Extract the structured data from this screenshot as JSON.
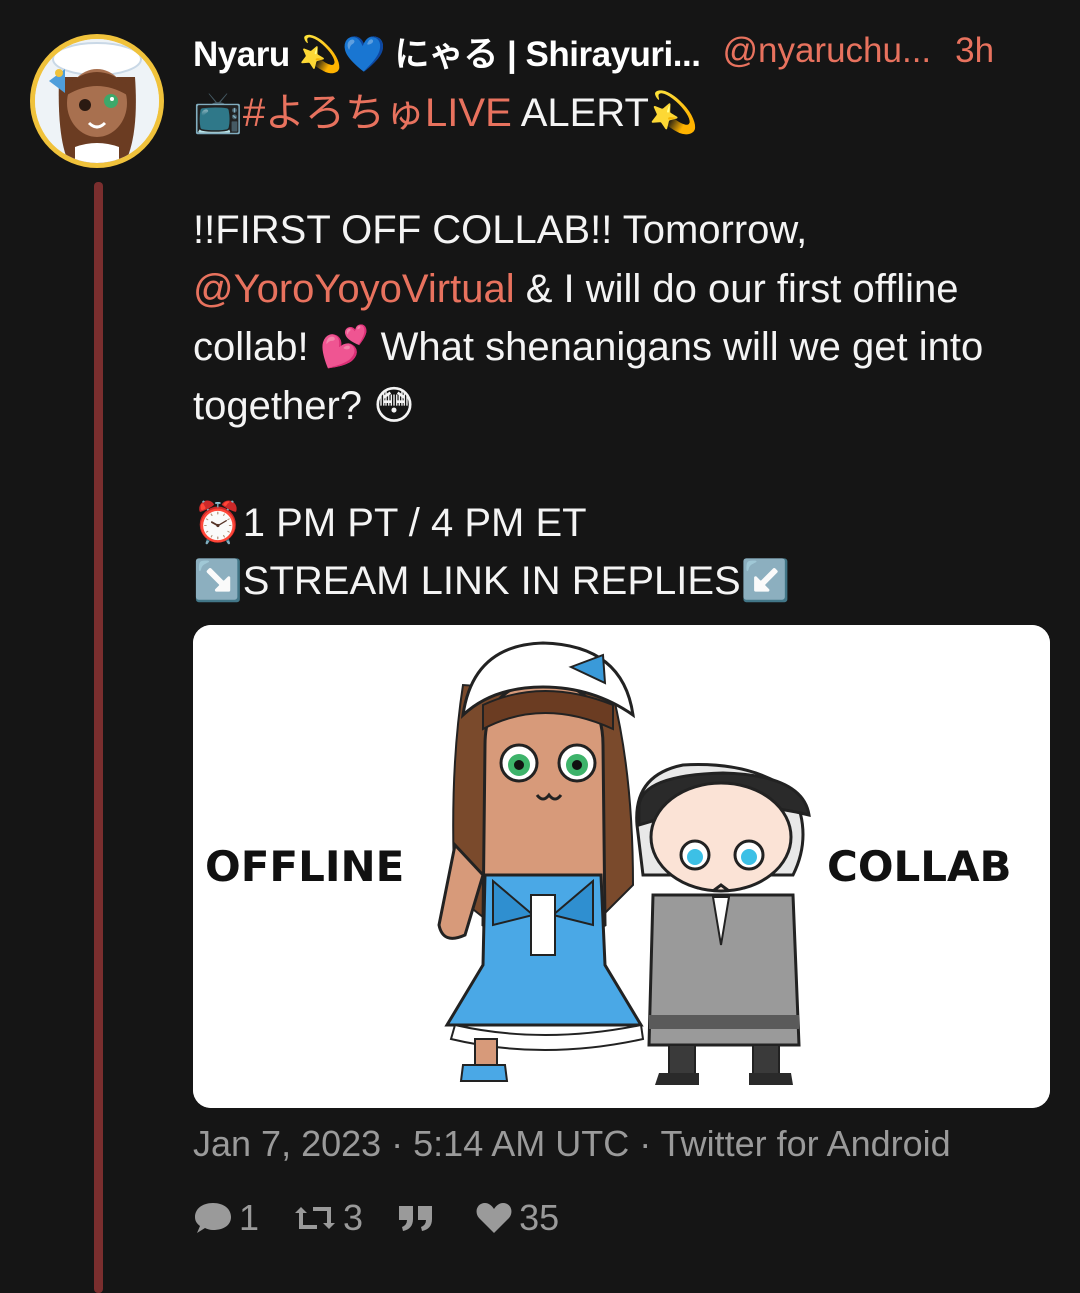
{
  "post": {
    "author": {
      "display_name": "Nyaru 💫💙 にゃる | Shirayuri...",
      "handle": "@nyaruchu...",
      "time_ago": "3h"
    },
    "text": {
      "line1_tag": "#よろちゅLIVE",
      "line1_rest": " ALERT💫",
      "line1_icon": "📺",
      "para2_start": "!!FIRST OFF COLLAB!! Tomorrow, ",
      "mention": "@YoroYoyoVirtual",
      "para2_end": " & I will do our first offline collab! 💕 What shenanigans will we get into together? 😳",
      "time_line": "⏰1 PM PT / 4 PM ET",
      "link_line": "↘️STREAM LINK IN REPLIES↙️"
    },
    "image": {
      "left_text": "OFFLINE",
      "right_text": "COLLAB"
    },
    "meta": "Jan 7, 2023 · 5:14 AM UTC · Twitter for Android",
    "stats": {
      "replies": "1",
      "retweets": "3",
      "quotes": "",
      "likes": "35"
    }
  },
  "icons": {
    "reply": "comment-icon",
    "retweet": "retweet-icon",
    "quote": "quote-icon",
    "like": "heart-icon"
  },
  "colors": {
    "background": "#151515",
    "link": "#e8725e",
    "muted": "#9a9a9a",
    "thread_line": "#7a2e2e",
    "avatar_ring": "#f0c23b"
  }
}
